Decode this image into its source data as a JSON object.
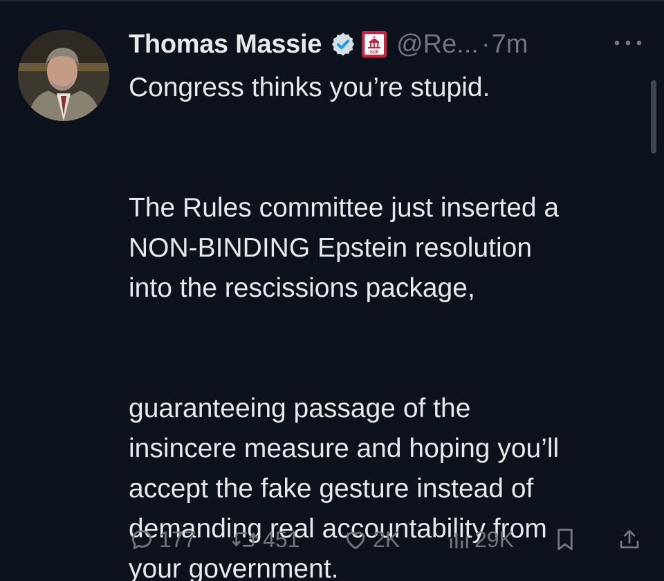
{
  "tweet": {
    "author_name": "Thomas Massie",
    "handle": "@Re...",
    "separator": "·",
    "time": "7m",
    "paragraphs": [
      [
        "Congress thinks you’re stupid."
      ],
      [
        "The Rules committee just inserted a",
        "NON-BINDING Epstein resolution",
        "into the rescissions package,"
      ],
      [
        "guaranteeing passage of the",
        "insincere measure and hoping you’ll",
        "accept the fake gesture instead of",
        "demanding real accountability from",
        "your government."
      ]
    ]
  },
  "badges": {
    "verified_icon": "verified-badge-icon",
    "affiliation_icon": "house-gop-affiliation-icon",
    "affiliation_text": "GOP",
    "verified_color": "#1d9bf0",
    "affiliation_color": "#d21f3c"
  },
  "actions": {
    "replies": "177",
    "reposts": "451",
    "likes": "2K",
    "views": "29K"
  },
  "colors": {
    "background": "#0b121b",
    "text": "#e7e9ea",
    "muted": "#71767b"
  }
}
